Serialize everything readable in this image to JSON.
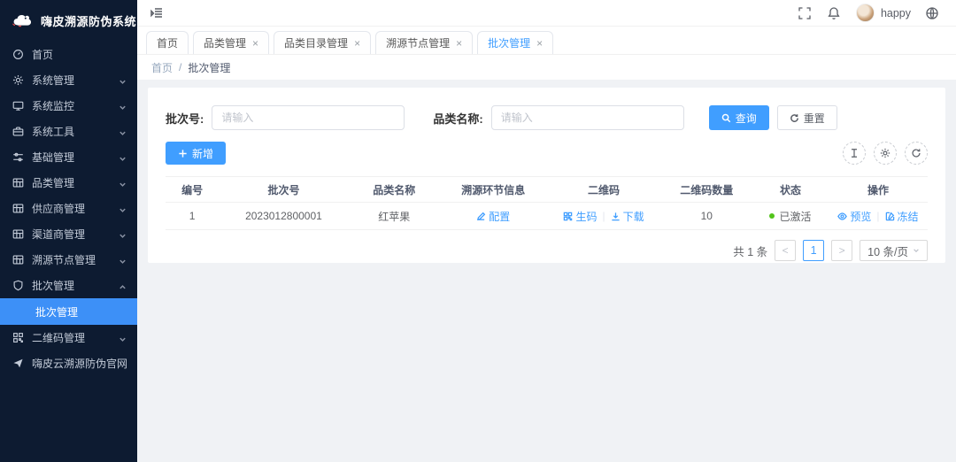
{
  "colors": {
    "primary": "#409eff",
    "sidebar_bg": "#0d1b31",
    "active_menu_bg": "#3d90f7",
    "status_active_green": "#52c41a",
    "main_bg": "#f0f2f5"
  },
  "app": {
    "title": "嗨皮溯源防伪系统"
  },
  "topbar": {
    "username": "happy"
  },
  "sidebar": {
    "items": [
      {
        "label": "首页"
      },
      {
        "label": "系统管理"
      },
      {
        "label": "系统监控"
      },
      {
        "label": "系统工具"
      },
      {
        "label": "基础管理"
      },
      {
        "label": "品类管理"
      },
      {
        "label": "供应商管理"
      },
      {
        "label": "渠道商管理"
      },
      {
        "label": "溯源节点管理"
      },
      {
        "label": "批次管理"
      },
      {
        "label": "二维码管理"
      },
      {
        "label": "嗨皮云溯源防伪官网"
      }
    ],
    "active_sub_item": {
      "label": "批次管理"
    }
  },
  "tabs": [
    {
      "label": "首页"
    },
    {
      "label": "品类管理"
    },
    {
      "label": "品类目录管理"
    },
    {
      "label": "溯源节点管理"
    },
    {
      "label": "批次管理"
    }
  ],
  "icons": {
    "close": "×",
    "prev": "<",
    "next": ">"
  },
  "breadcrumb": {
    "home": "首页",
    "separator": "/",
    "current": "批次管理"
  },
  "filters": {
    "batch_label": "批次号:",
    "batch_placeholder": "请输入",
    "category_label": "品类名称:",
    "category_placeholder": "请输入",
    "search_label": "查询",
    "reset_label": "重置"
  },
  "toolbar": {
    "add_label": "新增"
  },
  "table": {
    "columns": [
      "编号",
      "批次号",
      "品类名称",
      "溯源环节信息",
      "二维码",
      "二维码数量",
      "状态",
      "操作"
    ],
    "row": {
      "index": "1",
      "batch_no": "2023012800001",
      "category_name": "红苹果",
      "config_label": "配置",
      "generate_label": "生码",
      "download_label": "下载",
      "qr_count": "10",
      "status_label": "已激活",
      "preview_label": "预览",
      "freeze_label": "冻结"
    }
  },
  "pagination": {
    "total_label": "共 1 条",
    "current_page": "1",
    "page_size_label": "10 条/页"
  }
}
